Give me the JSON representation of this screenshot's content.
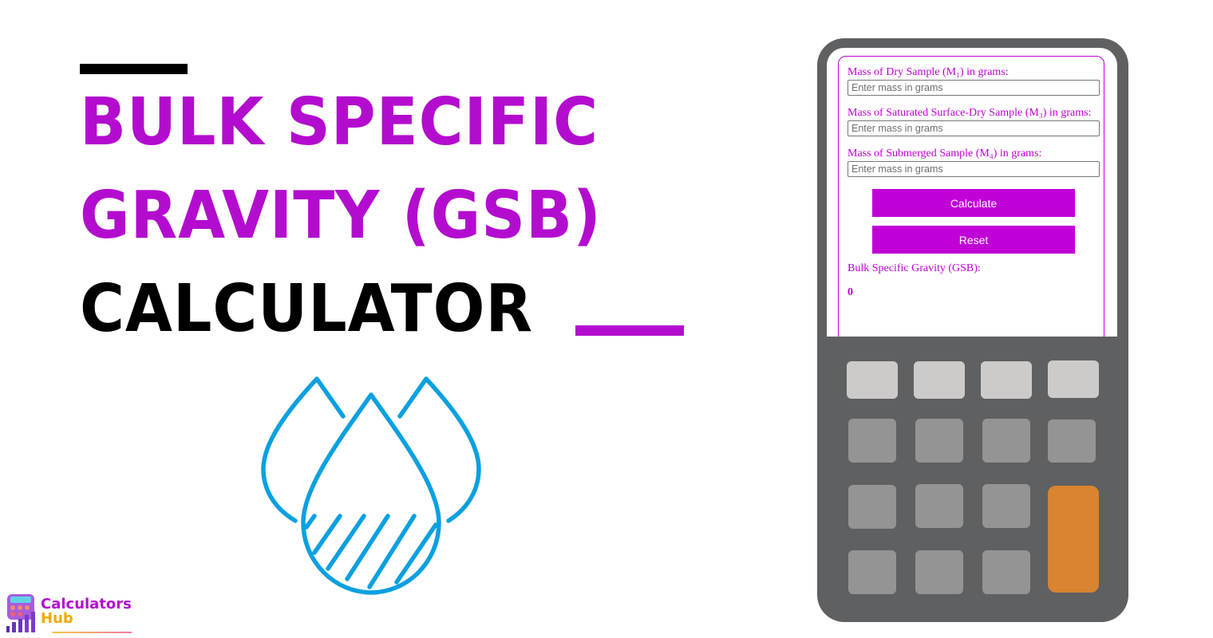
{
  "banner": {
    "title_line1": "Bulk Specific",
    "title_line2": "Gravity (GSB)",
    "title_line3": "Calculator",
    "accent_color": "#b30ccf",
    "illustration": "water-drops-icon"
  },
  "logo": {
    "line1": "Calculators",
    "line2": "Hub",
    "icon": "calculator-chart-logo-icon"
  },
  "calculator": {
    "fields": [
      {
        "label": "Mass of Dry Sample (M₁) in grams:",
        "placeholder": "Enter mass in grams",
        "value": ""
      },
      {
        "label": "Mass of Saturated Surface-Dry Sample (M₃) in grams:",
        "placeholder": "Enter mass in grams",
        "value": ""
      },
      {
        "label": "Mass of Submerged Sample (M₄) in grams:",
        "placeholder": "Enter mass in grams",
        "value": ""
      }
    ],
    "calculate_label": "Calculate",
    "reset_label": "Reset",
    "result_label": "Bulk Specific Gravity (GSB):",
    "result_value": "0",
    "button_color": "#c000d6",
    "orange_key_color": "#d98430"
  }
}
